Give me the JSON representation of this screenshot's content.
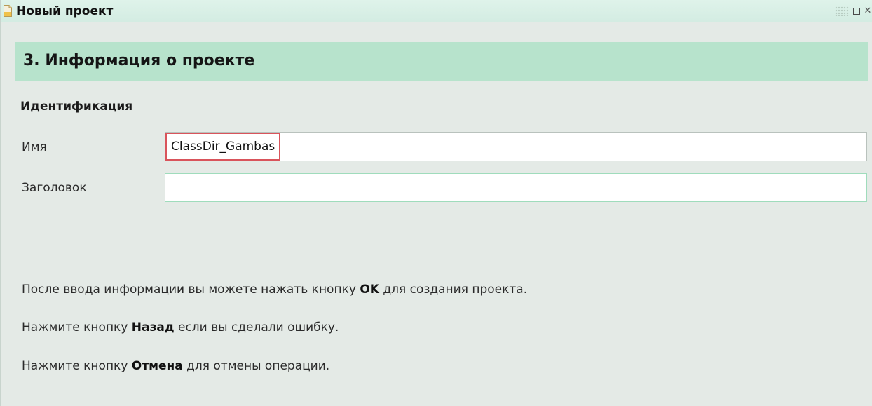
{
  "window": {
    "title": "Новый проект",
    "icon": "document-icon",
    "controls": [
      "restore-icon",
      "close-icon"
    ]
  },
  "step": {
    "title": "3. Информация о проекте"
  },
  "identification": {
    "section_title": "Идентификация",
    "name_label": "Имя",
    "name_value": "ClassDir_Gambas",
    "caption_label": "Заголовок",
    "caption_value": ""
  },
  "instructions": [
    {
      "before": "После ввода информации вы можете нажать кнопку ",
      "bold": "OK",
      "after": " для создания проекта."
    },
    {
      "before": "Нажмите кнопку ",
      "bold": "Назад",
      "after": " если вы сделали ошибку."
    },
    {
      "before": "Нажмите кнопку ",
      "bold": "Отмена",
      "after": " для отмены операции."
    }
  ],
  "colors": {
    "background": "#e4eae6",
    "titlebar": "#d3ece2",
    "step_header": "#b7e3cc",
    "name_highlight_border": "#d9545b",
    "caption_border": "#9fdcbc"
  }
}
